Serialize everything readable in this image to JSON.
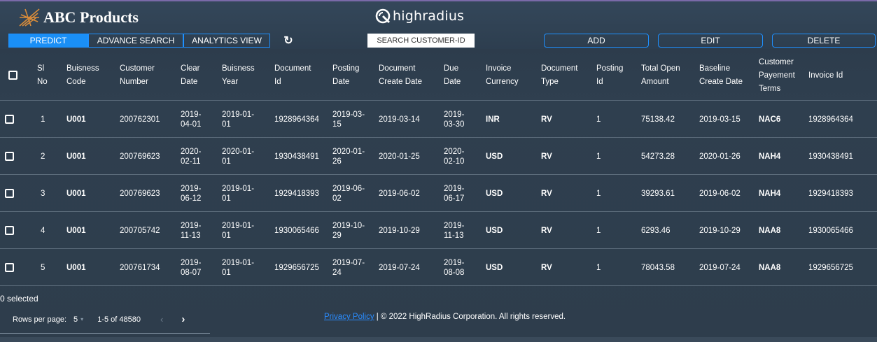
{
  "header": {
    "brand_title": "ABC Products",
    "company_logo_text": "highradius",
    "tabs": [
      {
        "label": "PREDICT",
        "active": true
      },
      {
        "label": "ADVANCE SEARCH",
        "active": false
      },
      {
        "label": "ANALYTICS VIEW",
        "active": false
      }
    ],
    "search_label": "SEARCH CUSTOMER-ID",
    "add_label": "ADD",
    "edit_label": "EDIT",
    "delete_label": "DELETE",
    "accent_color": "#1a8ff6"
  },
  "table": {
    "columns": [
      [
        "Sl",
        "No"
      ],
      [
        "Buisness",
        "Code"
      ],
      [
        "Customer",
        "Number"
      ],
      [
        "Clear",
        "Date"
      ],
      [
        "Buisness",
        "Year"
      ],
      [
        "Document",
        "Id"
      ],
      [
        "Posting",
        "Date"
      ],
      [
        "Document",
        "Create Date"
      ],
      [
        "Due",
        "Date"
      ],
      [
        "Invoice",
        "Currency"
      ],
      [
        "Document",
        "Type"
      ],
      [
        "Posting",
        "Id"
      ],
      [
        "Total Open",
        "Amount"
      ],
      [
        "Baseline",
        "Create Date"
      ],
      [
        "Customer",
        "Payement",
        "Terms"
      ],
      [
        "Invoice Id"
      ]
    ],
    "rows": [
      {
        "sl": "1",
        "business_code": "U001",
        "customer_number": "200762301",
        "clear_date": [
          "2019-",
          "04-01"
        ],
        "business_year": [
          "2019-01-",
          "01"
        ],
        "document_id": "1928964364",
        "posting_date": [
          "2019-03-",
          "15"
        ],
        "document_create_date": "2019-03-14",
        "due_date": [
          "2019-",
          "03-30"
        ],
        "invoice_currency": "INR",
        "document_type": "RV",
        "posting_id": "1",
        "total_open_amount": "75138.42",
        "baseline_create_date": "2019-03-15",
        "payment_terms": "NAC6",
        "invoice_id": "1928964364"
      },
      {
        "sl": "2",
        "business_code": "U001",
        "customer_number": "200769623",
        "clear_date": [
          "2020-",
          "02-11"
        ],
        "business_year": [
          "2020-01-",
          "01"
        ],
        "document_id": "1930438491",
        "posting_date": [
          "2020-01-",
          "26"
        ],
        "document_create_date": "2020-01-25",
        "due_date": [
          "2020-",
          "02-10"
        ],
        "invoice_currency": "USD",
        "document_type": "RV",
        "posting_id": "1",
        "total_open_amount": "54273.28",
        "baseline_create_date": "2020-01-26",
        "payment_terms": "NAH4",
        "invoice_id": "1930438491"
      },
      {
        "sl": "3",
        "business_code": "U001",
        "customer_number": "200769623",
        "clear_date": [
          "2019-",
          "06-12"
        ],
        "business_year": [
          "2019-01-",
          "01"
        ],
        "document_id": "1929418393",
        "posting_date": [
          "2019-06-",
          "02"
        ],
        "document_create_date": "2019-06-02",
        "due_date": [
          "2019-",
          "06-17"
        ],
        "invoice_currency": "USD",
        "document_type": "RV",
        "posting_id": "1",
        "total_open_amount": "39293.61",
        "baseline_create_date": "2019-06-02",
        "payment_terms": "NAH4",
        "invoice_id": "1929418393"
      },
      {
        "sl": "4",
        "business_code": "U001",
        "customer_number": "200705742",
        "clear_date": [
          "2019-",
          "11-13"
        ],
        "business_year": [
          "2019-01-",
          "01"
        ],
        "document_id": "1930065466",
        "posting_date": [
          "2019-10-",
          "29"
        ],
        "document_create_date": "2019-10-29",
        "due_date": [
          "2019-",
          "11-13"
        ],
        "invoice_currency": "USD",
        "document_type": "RV",
        "posting_id": "1",
        "total_open_amount": "6293.46",
        "baseline_create_date": "2019-10-29",
        "payment_terms": "NAA8",
        "invoice_id": "1930065466"
      },
      {
        "sl": "5",
        "business_code": "U001",
        "customer_number": "200761734",
        "clear_date": [
          "2019-",
          "08-07"
        ],
        "business_year": [
          "2019-01-",
          "01"
        ],
        "document_id": "1929656725",
        "posting_date": [
          "2019-07-",
          "24"
        ],
        "document_create_date": "2019-07-24",
        "due_date": [
          "2019-",
          "08-08"
        ],
        "invoice_currency": "USD",
        "document_type": "RV",
        "posting_id": "1",
        "total_open_amount": "78043.58",
        "baseline_create_date": "2019-07-24",
        "payment_terms": "NAA8",
        "invoice_id": "1929656725"
      }
    ]
  },
  "footer": {
    "selected_text": "0 selected",
    "rows_per_page_label": "Rows per page:",
    "rows_per_page_value": "5",
    "page_range": "1-5 of 48580",
    "privacy_link": "Privacy Policy",
    "copyright": " | © 2022 HighRadius Corporation. All rights reserved."
  }
}
